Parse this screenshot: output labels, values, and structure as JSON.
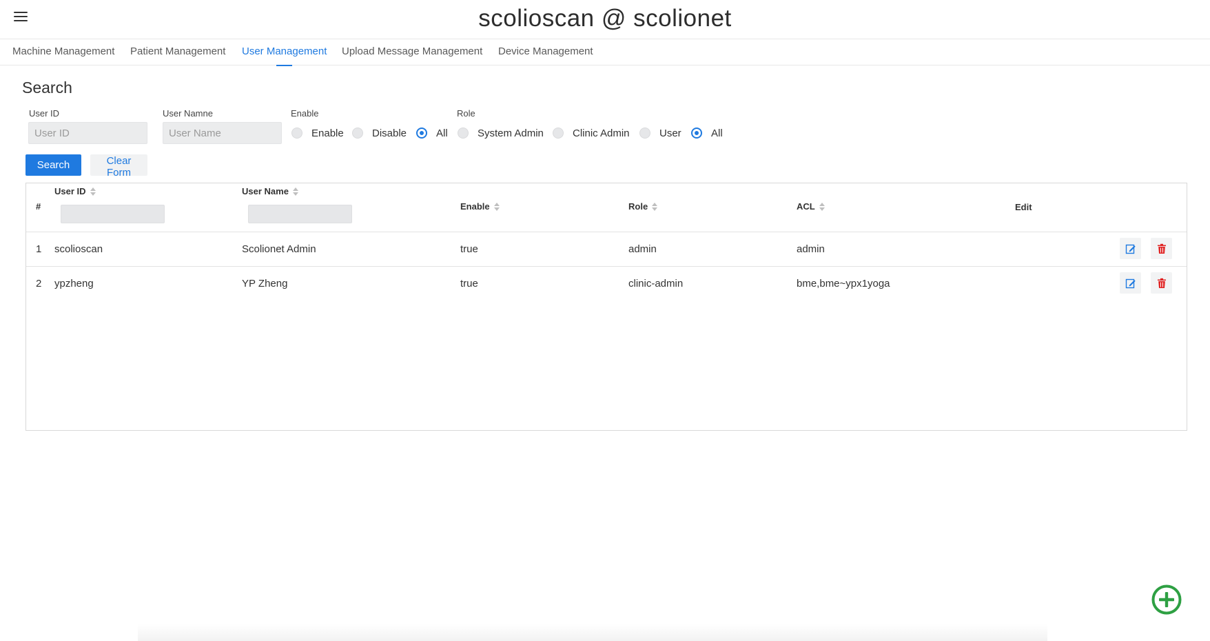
{
  "header": {
    "title": "scolioscan @ scolionet",
    "menu_icon": "hamburger-menu-icon"
  },
  "tabs": [
    {
      "label": "Machine Management",
      "active": false
    },
    {
      "label": "Patient Management",
      "active": false
    },
    {
      "label": "User Management",
      "active": true
    },
    {
      "label": "Upload Message Management",
      "active": false
    },
    {
      "label": "Device Management",
      "active": false
    }
  ],
  "search": {
    "title": "Search",
    "user_id_label": "User ID",
    "user_id_placeholder": "User ID",
    "user_id_value": "",
    "user_name_label": "User Namne",
    "user_name_placeholder": "User Name",
    "user_name_value": "",
    "enable_label": "Enable",
    "enable_options": [
      "Enable",
      "Disable",
      "All"
    ],
    "enable_selected": "All",
    "role_label": "Role",
    "role_options": [
      "System Admin",
      "Clinic Admin",
      "User",
      "All"
    ],
    "role_selected": "All",
    "search_button": "Search",
    "clear_button": "Clear Form"
  },
  "table": {
    "columns": {
      "index": "#",
      "user_id": "User ID",
      "user_name": "User Name",
      "enable": "Enable",
      "role": "Role",
      "acl": "ACL",
      "edit": "Edit"
    },
    "rows": [
      {
        "index": "1",
        "user_id": "scolioscan",
        "user_name": "Scolionet Admin",
        "enable": "true",
        "role": "admin",
        "acl": "admin"
      },
      {
        "index": "2",
        "user_id": "ypzheng",
        "user_name": "YP Zheng",
        "enable": "true",
        "role": "clinic-admin",
        "acl": "bme,bme~ypx1yoga"
      }
    ]
  },
  "colors": {
    "accent": "#1f7ae0",
    "delete": "#e02424",
    "add": "#2ea043"
  },
  "icons": {
    "edit": "edit-icon",
    "delete": "trash-icon",
    "add": "add-circle-icon"
  }
}
